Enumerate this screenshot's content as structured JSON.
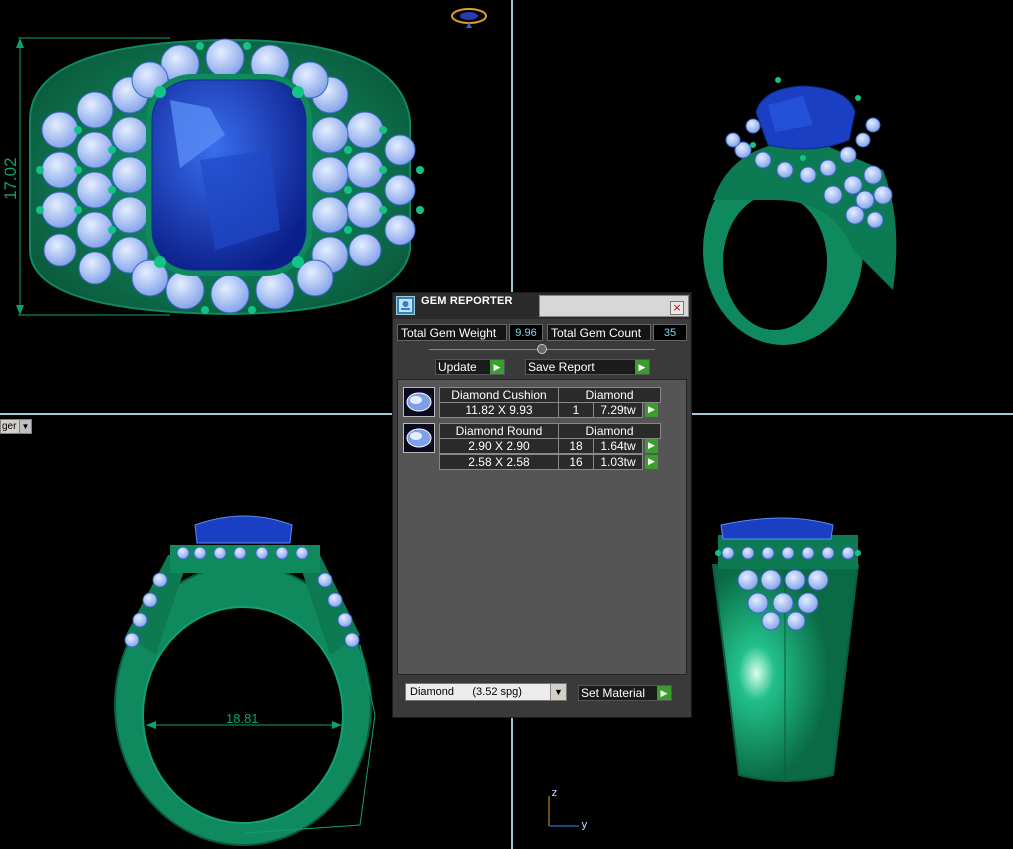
{
  "viewport": {
    "front_dimension": "17.02",
    "side_dimension": "18.81",
    "view_dropdown_text": "ger",
    "axis_z": "z",
    "axis_y": "y"
  },
  "panel": {
    "title": "GEM REPORTER",
    "close_icon": "×",
    "total_gem_weight_label": "Total Gem Weight",
    "total_gem_weight_value": "9.96",
    "total_gem_count_label": "Total Gem Count",
    "total_gem_count_value": "35",
    "update_label": "Update",
    "save_report_label": "Save Report",
    "groups": [
      {
        "shape": "Diamond Cushion",
        "material": "Diamond",
        "rows": [
          {
            "size": "11.82 X 9.93",
            "count": "1",
            "weight": "7.29tw"
          }
        ]
      },
      {
        "shape": "Diamond Round",
        "material": "Diamond",
        "rows": [
          {
            "size": "2.90 X 2.90",
            "count": "18",
            "weight": "1.64tw"
          },
          {
            "size": "2.58 X 2.58",
            "count": "16",
            "weight": "1.03tw"
          }
        ]
      }
    ],
    "material_select": "Diamond      (3.52 spg)",
    "set_material_label": "Set Material"
  },
  "colors": {
    "metal": "#0f8a5f",
    "gem_center": "#1a3fc2",
    "gem_side": "#a8c4ff",
    "accent_green": "#3a9e2e"
  }
}
